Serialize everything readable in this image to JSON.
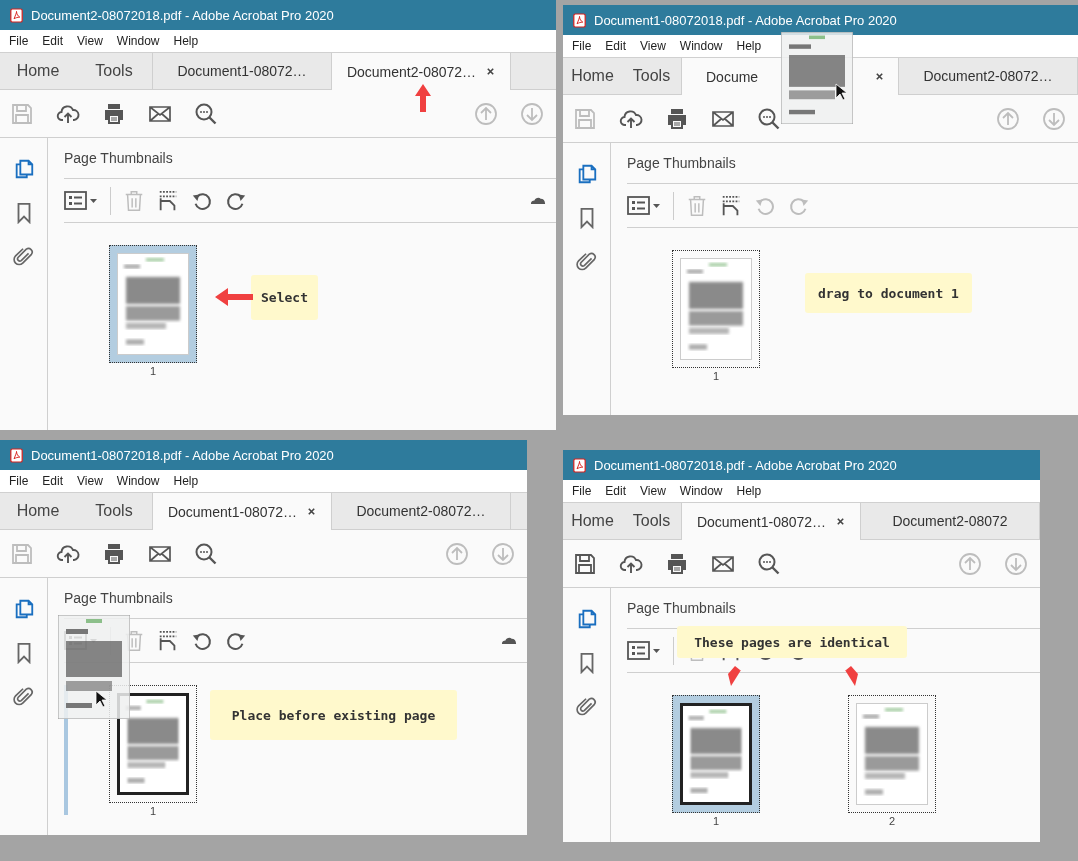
{
  "windows": [
    {
      "title": "Document2-08072018.pdf - Adobe Acrobat Pro 2020",
      "menu": [
        "File",
        "Edit",
        "View",
        "Window",
        "Help"
      ],
      "tabs": [
        {
          "label": "Home",
          "kind": "nav",
          "selected": false
        },
        {
          "label": "Tools",
          "kind": "nav",
          "selected": false
        },
        {
          "label": "Document1-08072…",
          "kind": "doc",
          "selected": false
        },
        {
          "label": "Document2-08072…",
          "kind": "doc",
          "selected": true
        }
      ],
      "save_disabled": true,
      "rotate_disabled": false,
      "options_menu": true,
      "tab_arrow": true,
      "panel_title": "Page Thumbnails",
      "thumbnails": [
        {
          "number": "1",
          "selected": true,
          "outlined": false
        }
      ],
      "callout": {
        "text": "Select",
        "left_arrow": true
      }
    },
    {
      "title": "Document1-08072018.pdf - Adobe Acrobat Pro 2020",
      "menu": [
        "File",
        "Edit",
        "View",
        "Window",
        "Help"
      ],
      "tabs": [
        {
          "label": "Home",
          "kind": "nav",
          "selected": false
        },
        {
          "label": "Tools",
          "kind": "nav",
          "selected": false
        },
        {
          "label": "Docume",
          "kind": "doc",
          "selected": true
        },
        {
          "label": "Document2-08072…",
          "kind": "doc",
          "selected": false
        }
      ],
      "save_disabled": true,
      "rotate_disabled": true,
      "panel_title": "Page Thumbnails",
      "thumbnails": [
        {
          "number": "1",
          "selected": false,
          "outlined": false
        }
      ],
      "callout": {
        "text": "drag to document 1"
      },
      "drag_preview": {
        "kind": "picture"
      }
    },
    {
      "title": "Document1-08072018.pdf - Adobe Acrobat Pro 2020",
      "menu": [
        "File",
        "Edit",
        "View",
        "Window",
        "Help"
      ],
      "tabs": [
        {
          "label": "Home",
          "kind": "nav",
          "selected": false
        },
        {
          "label": "Tools",
          "kind": "nav",
          "selected": false
        },
        {
          "label": "Document1-08072…",
          "kind": "doc",
          "selected": true
        },
        {
          "label": "Document2-08072…",
          "kind": "doc",
          "selected": false
        }
      ],
      "save_disabled": true,
      "rotate_disabled": false,
      "options_menu": true,
      "panel_title": "Page Thumbnails",
      "thumbnails": [
        {
          "number": "1",
          "selected": false,
          "outlined": true,
          "insert_before": true
        }
      ],
      "callout": {
        "text": "Place before existing page"
      },
      "drag_preview": {
        "kind": "picture"
      }
    },
    {
      "title": "Document1-08072018.pdf - Adobe Acrobat Pro 2020",
      "menu": [
        "File",
        "Edit",
        "View",
        "Window",
        "Help"
      ],
      "tabs": [
        {
          "label": "Home",
          "kind": "nav",
          "selected": false
        },
        {
          "label": "Tools",
          "kind": "nav",
          "selected": false
        },
        {
          "label": "Document1-08072…",
          "kind": "doc",
          "selected": true
        },
        {
          "label": "Document2-08072",
          "kind": "doc",
          "selected": false
        }
      ],
      "save_disabled": false,
      "rotate_disabled": false,
      "panel_title": "Page Thumbnails",
      "thumbnails": [
        {
          "number": "1",
          "selected": true,
          "outlined": true
        },
        {
          "number": "2",
          "selected": false,
          "outlined": false
        }
      ],
      "callout": {
        "text": "These pages are identical",
        "down_arrows": true
      }
    }
  ]
}
